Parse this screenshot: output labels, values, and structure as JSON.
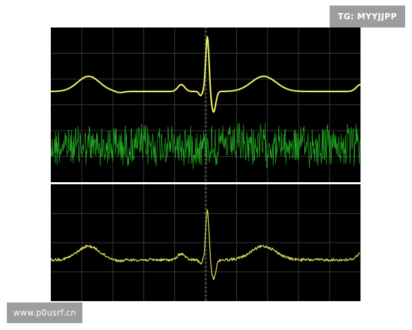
{
  "watermarks": {
    "top_right": "TG: MYYJJPP",
    "bottom_left": "www.p0usrf.cn"
  },
  "colors": {
    "background": "#ffffff",
    "screen": "#000000",
    "grid": "#3a3a3a",
    "clean_trace": "#eeee66",
    "noise_trace": "#22aa22",
    "badge": "#9d9d9d"
  },
  "scopes": [
    {
      "panel": "top",
      "traces": [
        "clean-ecg",
        "green-noise"
      ]
    },
    {
      "panel": "bottom",
      "traces": [
        "noisy-ecg"
      ]
    }
  ]
}
